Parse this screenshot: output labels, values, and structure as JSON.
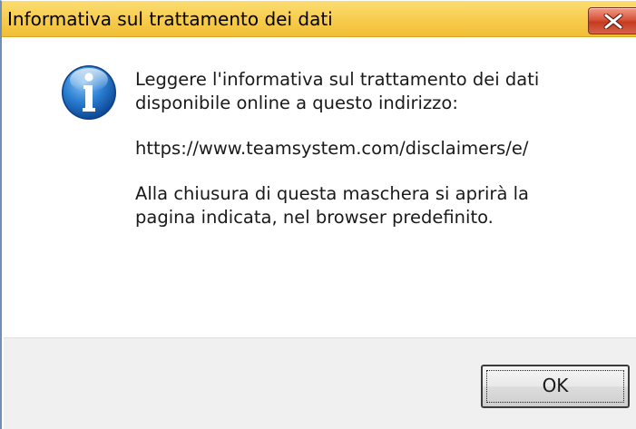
{
  "window": {
    "title": "Informativa sul trattamento dei dati",
    "close_icon": "close-x-icon"
  },
  "content": {
    "icon": "information-icon",
    "lines": {
      "line1": "Leggere l'informativa sul trattamento dei dati",
      "line2": "disponibile online a questo indirizzo:",
      "url": "https://www.teamsystem.com/disclaimers/e/",
      "line4": "Alla chiusura di questa maschera si aprirà la",
      "line5": "pagina indicata, nel browser predefinito."
    }
  },
  "footer": {
    "ok_label": "OK"
  },
  "colors": {
    "titlebar": "#f8cf52",
    "close_button": "#c53b20",
    "info_icon": "#1f6fc2",
    "footer_background": "#f0f0f0"
  }
}
